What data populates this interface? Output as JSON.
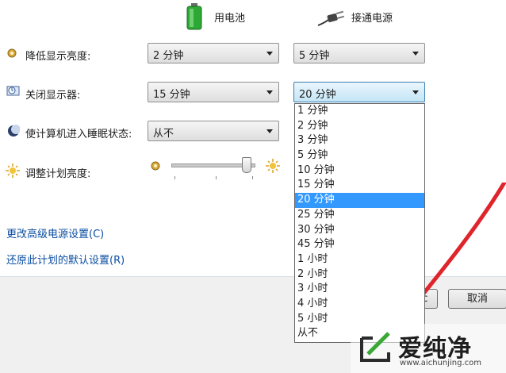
{
  "headers": {
    "battery_label": "用电池",
    "plugged_label": "接通电源"
  },
  "rows": [
    {
      "label": "降低显示亮度:",
      "battery": "2 分钟",
      "plugged": "5 分钟"
    },
    {
      "label": "关闭显示器:",
      "battery": "15 分钟",
      "plugged": "20 分钟"
    },
    {
      "label": "使计算机进入睡眠状态:",
      "battery": "从不"
    }
  ],
  "brightness": {
    "label": "调整计划亮度:",
    "level": 0.92
  },
  "dropdown": {
    "options": [
      "1 分钟",
      "2 分钟",
      "3 分钟",
      "5 分钟",
      "10 分钟",
      "15 分钟",
      "20 分钟",
      "25 分钟",
      "30 分钟",
      "45 分钟",
      "1 小时",
      "2 小时",
      "3 小时",
      "4 小时",
      "5 小时",
      "从不"
    ],
    "selected": "20 分钟"
  },
  "links": {
    "advanced": "更改高级电源设置(C)",
    "restore": "还原此计划的默认设置(R)"
  },
  "buttons": {
    "cancel": "取消",
    "save_partial": "c"
  },
  "watermark": {
    "brand": "爱纯净",
    "url": "www.aichunjing.com"
  },
  "colors": {
    "link": "#0b4ea2",
    "selection": "#3399ff",
    "arrow": "#e0242b"
  }
}
